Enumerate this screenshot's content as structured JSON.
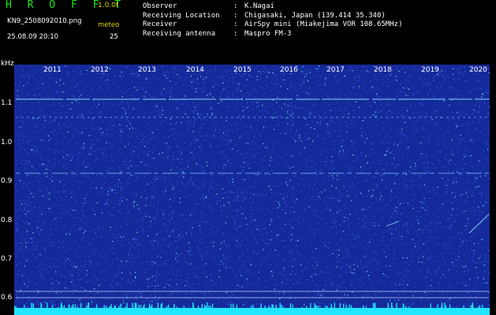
{
  "header": {
    "app_title": "H R O F F T",
    "version": "1.0.0f",
    "filename": "KN9_2508092010.png",
    "meteo_label": "meteo",
    "datetime": "25.08.09 20:10",
    "meteo_value": "25",
    "info": [
      {
        "key": "Observer",
        "sep": ":",
        "value": "K.Nagai"
      },
      {
        "key": "Receiving Location",
        "sep": ":",
        "value": "Chigasaki, Japan (139.414 35.340)"
      },
      {
        "key": "Receiver",
        "sep": ":",
        "value": "AirSpy mini (Miakejima VOR 108.65MHz)"
      },
      {
        "key": "Receiving antenna",
        "sep": ":",
        "value": "Maspro FM-3"
      }
    ]
  },
  "spectrogram": {
    "y_unit": "kHz",
    "x_ticks": [
      "2011",
      "2012",
      "2013",
      "2014",
      "2015",
      "2016",
      "2017",
      "2018",
      "2019",
      "2020"
    ],
    "y_ticks": [
      "1.1",
      "1.0",
      "0.9",
      "0.8",
      "0.7",
      "0.6"
    ],
    "colors": {
      "background": "#152a9a",
      "noise": "#3a6cff",
      "bright": "#7ff4ff",
      "baseline": "#22e5ff"
    }
  }
}
